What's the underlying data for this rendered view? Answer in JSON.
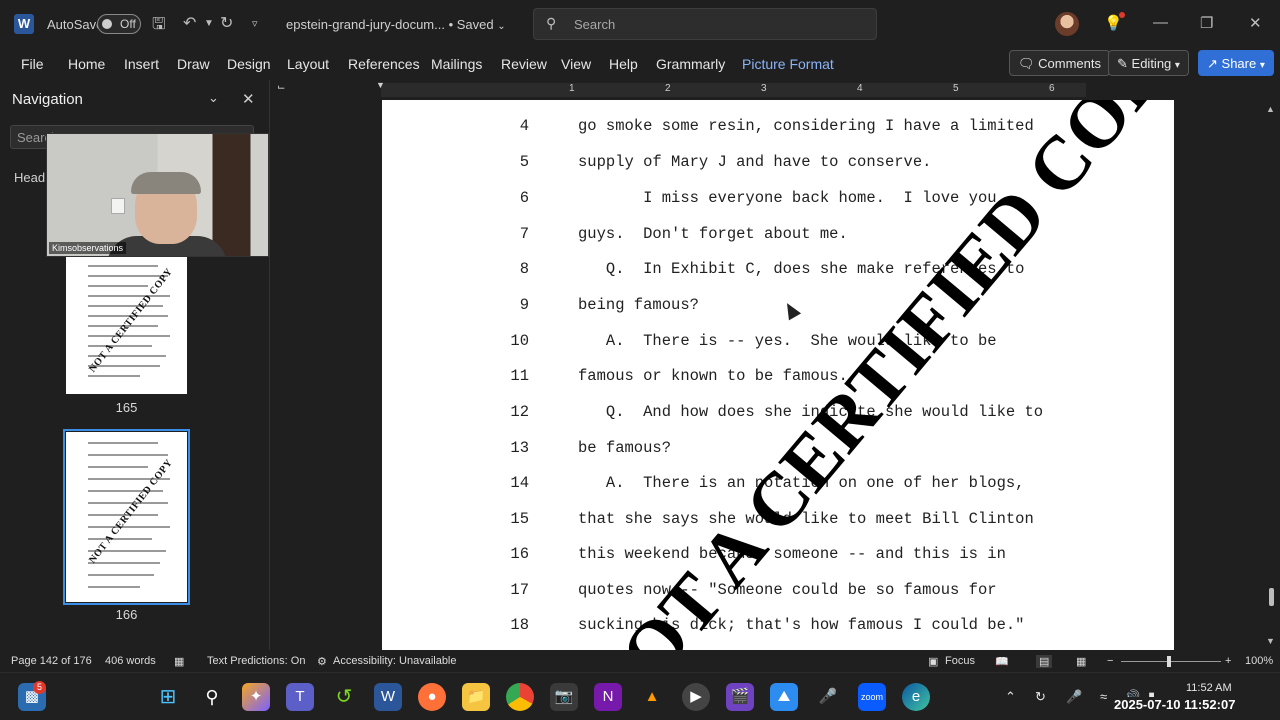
{
  "titlebar": {
    "app_letter": "W",
    "autosave_label": "AutoSave",
    "autosave_state": "Off",
    "doc_name": "epstein-grand-jury-docum...",
    "saved_status": "• Saved",
    "search_placeholder": "Search"
  },
  "ribbon": {
    "tabs": [
      "File",
      "Home",
      "Insert",
      "Draw",
      "Design",
      "Layout",
      "References",
      "Mailings",
      "Review",
      "View",
      "Help",
      "Grammarly",
      "Picture Format"
    ],
    "comments_label": "Comments",
    "editing_label": "Editing",
    "share_label": "Share"
  },
  "navigation": {
    "title": "Navigation",
    "search_placeholder": "Search",
    "headings_tab": "Headi",
    "thumbnails": [
      {
        "page_number": "165",
        "stamp": "NOT A CERTIFIED COPY"
      },
      {
        "page_number": "166",
        "stamp": "NOT A CERTIFIED COPY"
      }
    ]
  },
  "webcam": {
    "name_tag": "Kimsobservations"
  },
  "ruler": {
    "numbers": [
      "1",
      "2",
      "3",
      "4",
      "5",
      "6"
    ]
  },
  "document": {
    "lines": [
      {
        "n": "4",
        "text": "go smoke some resin, considering I have a limited"
      },
      {
        "n": "5",
        "text": "supply of Mary J and have to conserve."
      },
      {
        "n": "6",
        "text": "       I miss everyone back home.  I love you"
      },
      {
        "n": "7",
        "text": "guys.  Don't forget about me."
      },
      {
        "n": "8",
        "text": "   Q.  In Exhibit C, does she make references to"
      },
      {
        "n": "9",
        "text": "being famous?"
      },
      {
        "n": "10",
        "text": "   A.  There is -- yes.  She would like to be"
      },
      {
        "n": "11",
        "text": "famous or known to be famous."
      },
      {
        "n": "12",
        "text": "   Q.  And how does she indicate she would like to"
      },
      {
        "n": "13",
        "text": "be famous?"
      },
      {
        "n": "14",
        "text": "   A.  There is an notation on one of her blogs,"
      },
      {
        "n": "15",
        "text": "that she says she would like to meet Bill Clinton"
      },
      {
        "n": "16",
        "text": "this weekend because someone -- and this is in"
      },
      {
        "n": "17",
        "text": "quotes now -- \"Someone could be so famous for"
      },
      {
        "n": "18",
        "text": "sucking his dick; that's how famous I could be.\""
      }
    ],
    "watermark": "NOT A CERTIFIED COPY"
  },
  "statusbar": {
    "page_info": "Page 142 of 176",
    "word_count": "406 words",
    "text_predictions": "Text Predictions: On",
    "accessibility": "Accessibility: Unavailable",
    "focus": "Focus",
    "zoom": "100%"
  },
  "taskbar": {
    "notification_count": "5",
    "time": "11:52 AM",
    "date_overlay": "2025-07-10 11:52:07"
  }
}
